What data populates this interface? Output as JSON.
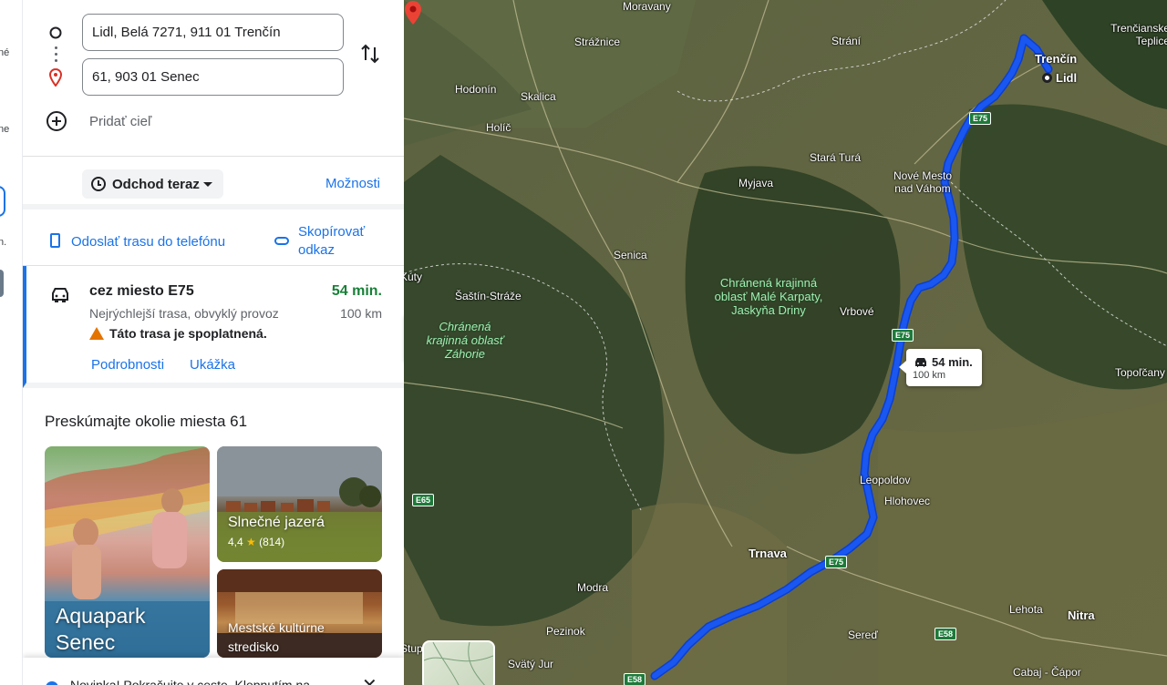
{
  "rail": {
    "labels": [
      "né",
      "ne",
      "n."
    ]
  },
  "directions": {
    "origin_value": "Lidl, Belá 7271, 911 01 Trenčín",
    "destination_value": "61, 903 01 Senec",
    "add_destination": "Pridať cieľ",
    "depart_label": "Odchod teraz",
    "options_label": "Možnosti"
  },
  "share": {
    "send_to_phone": "Odoslať trasu do telefónu",
    "copy_link": "Skopírovať odkaz"
  },
  "route": {
    "via": "cez miesto E75",
    "duration": "54 min.",
    "description": "Nejrýchlejší trasa, obvyklý provoz",
    "distance": "100 km",
    "toll_notice": "Táto trasa je spoplatnená.",
    "details_link": "Podrobnosti",
    "preview_link": "Ukážka"
  },
  "explore": {
    "title": "Preskúmajte okolie miesta 61",
    "cards": [
      {
        "name": "Aquapark Senec"
      },
      {
        "name": "Slnečné jazerá",
        "rating": "4,4",
        "reviews": "(814)"
      },
      {
        "name": "Mestské kultúrne stredisko"
      }
    ]
  },
  "toast": {
    "message": "Novinka! Pokračujte v ceste. Klepnutím na"
  },
  "map": {
    "callout_time": "54 min.",
    "callout_distance": "100 km",
    "route_color": "#1a56f0",
    "places": [
      {
        "id": "straznice",
        "name": "Strážnice"
      },
      {
        "id": "strani",
        "name": "Strání"
      },
      {
        "id": "hodonin",
        "name": "Hodonín"
      },
      {
        "id": "skalica",
        "name": "Skalica"
      },
      {
        "id": "holic",
        "name": "Holíč"
      },
      {
        "id": "trencin",
        "name": "Trenčín"
      },
      {
        "id": "lidl",
        "name": "Lidl"
      },
      {
        "id": "trencianske",
        "name": "Trenčianske Teplice"
      },
      {
        "id": "stara-tura",
        "name": "Stará Turá"
      },
      {
        "id": "myjava",
        "name": "Myjava"
      },
      {
        "id": "nove-mesto",
        "name": "Nové Mesto nad Váhom"
      },
      {
        "id": "senica",
        "name": "Senica"
      },
      {
        "id": "kuty",
        "name": "Kúty"
      },
      {
        "id": "sastin",
        "name": "Šaštín-Stráže"
      },
      {
        "id": "vrbove",
        "name": "Vrbové"
      },
      {
        "id": "topolcany",
        "name": "Topoľčany"
      },
      {
        "id": "leopoldov",
        "name": "Leopoldov"
      },
      {
        "id": "hlohovec",
        "name": "Hlohovec"
      },
      {
        "id": "trnava",
        "name": "Trnava"
      },
      {
        "id": "modra",
        "name": "Modra"
      },
      {
        "id": "pezinok",
        "name": "Pezinok"
      },
      {
        "id": "sered",
        "name": "Sereď"
      },
      {
        "id": "lehota",
        "name": "Lehota"
      },
      {
        "id": "nitra",
        "name": "Nitra"
      },
      {
        "id": "svaty-jur",
        "name": "Svätý Jur"
      },
      {
        "id": "cabaj",
        "name": "Cabaj - Čápor"
      },
      {
        "id": "stupava",
        "name": "Stupava"
      },
      {
        "id": "moravany",
        "name": "Moravany"
      }
    ],
    "parks": [
      {
        "id": "male-karpaty",
        "name": "Chránená krajinná oblasť Malé Karpaty, Jaskyňa Driny"
      },
      {
        "id": "zahorie",
        "name": "Chránená krajinná oblasť Záhorie"
      }
    ],
    "road_shields": [
      "E75",
      "E75",
      "E75",
      "E65",
      "E58",
      "E58"
    ]
  }
}
